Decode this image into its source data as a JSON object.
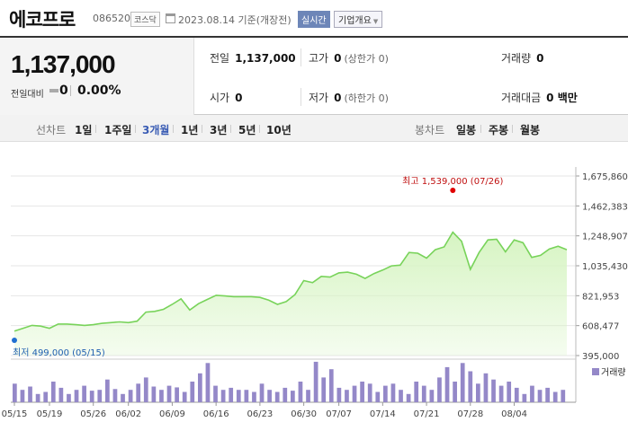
{
  "header": {
    "title": "에코프로",
    "code": "086520",
    "market": "코스닥",
    "date": "2023.08.14 기준(개장전)",
    "realtime_label": "실시간",
    "corp_info_label": "기업개요"
  },
  "summary": {
    "price": "1,137,000",
    "change_label": "전일대비",
    "change_value": "0",
    "change_pct": "0.00%",
    "prev_label": "전일",
    "prev_value": "1,137,000",
    "high_label": "고가",
    "high_value": "0",
    "high_sub": "(상한가 0)",
    "volume_label": "거래량",
    "volume_value": "0",
    "open_label": "시가",
    "open_value": "0",
    "low_label": "저가",
    "low_value": "0",
    "low_sub": "(하한가 0)",
    "amount_label": "거래대금",
    "amount_value": "0 백만"
  },
  "period_bar": {
    "line_label": "선차트",
    "line_options": [
      "1일",
      "1주일",
      "3개월",
      "1년",
      "3년",
      "5년",
      "10년"
    ],
    "line_selected": "3개월",
    "candle_label": "봉차트",
    "candle_options": [
      "일봉",
      "주봉",
      "월봉"
    ]
  },
  "chart_data": {
    "type": "line",
    "y_ticks": [
      "1,675,860",
      "1,462,383",
      "1,248,907",
      "1,035,430",
      "821,953",
      "608,477",
      "395,000"
    ],
    "ylim": [
      395000,
      1675860
    ],
    "x_ticks": [
      "05/15",
      "05/19",
      "05/26",
      "06/02",
      "06/09",
      "06/16",
      "06/23",
      "06/30",
      "07/07",
      "07/14",
      "07/21",
      "07/28",
      "08/04"
    ],
    "x_tick_index": [
      0,
      4,
      9,
      13,
      18,
      23,
      28,
      33,
      37,
      42,
      47,
      52,
      57
    ],
    "max_label": "최고 1,539,000 (07/26)",
    "min_label": "최저 499,000 (05/15)",
    "max_index": 50,
    "max_value": 1539000,
    "min_index": 0,
    "min_value": 499000,
    "volume_label": "거래량",
    "colors": {
      "line": "#78d35a",
      "fill": "#d6f4c2",
      "volume": "#9488c8",
      "max_dot": "#e00000",
      "min_dot": "#1f6fd1",
      "min_text": "#1f5fb0",
      "max_text": "#c01010"
    },
    "values": [
      570000,
      590000,
      610000,
      605000,
      590000,
      620000,
      620000,
      615000,
      610000,
      615000,
      625000,
      630000,
      635000,
      630000,
      640000,
      705000,
      710000,
      725000,
      760000,
      800000,
      720000,
      765000,
      795000,
      825000,
      820000,
      815000,
      815000,
      815000,
      810000,
      790000,
      760000,
      780000,
      830000,
      930000,
      915000,
      960000,
      955000,
      985000,
      990000,
      975000,
      945000,
      980000,
      1005000,
      1035000,
      1040000,
      1130000,
      1125000,
      1090000,
      1150000,
      1170000,
      1275000,
      1210000,
      1010000,
      1130000,
      1220000,
      1225000,
      1135000,
      1220000,
      1200000,
      1095000,
      1110000,
      1155000,
      1175000,
      1150000
    ],
    "volumes": [
      0.45,
      0.3,
      0.38,
      0.2,
      0.25,
      0.5,
      0.35,
      0.2,
      0.3,
      0.4,
      0.28,
      0.3,
      0.55,
      0.32,
      0.2,
      0.3,
      0.45,
      0.6,
      0.38,
      0.3,
      0.4,
      0.36,
      0.25,
      0.5,
      0.7,
      0.95,
      0.4,
      0.3,
      0.35,
      0.3,
      0.3,
      0.25,
      0.45,
      0.3,
      0.25,
      0.35,
      0.28,
      0.5,
      0.3,
      0.98,
      0.6,
      0.8,
      0.35,
      0.3,
      0.4,
      0.5,
      0.45,
      0.25,
      0.4,
      0.45,
      0.3,
      0.2,
      0.5,
      0.4,
      0.3,
      0.6,
      0.85,
      0.5,
      0.95,
      0.75,
      0.45,
      0.7,
      0.55,
      0.4,
      0.5,
      0.35,
      0.2,
      0.4,
      0.3,
      0.35,
      0.25,
      0.3
    ]
  }
}
